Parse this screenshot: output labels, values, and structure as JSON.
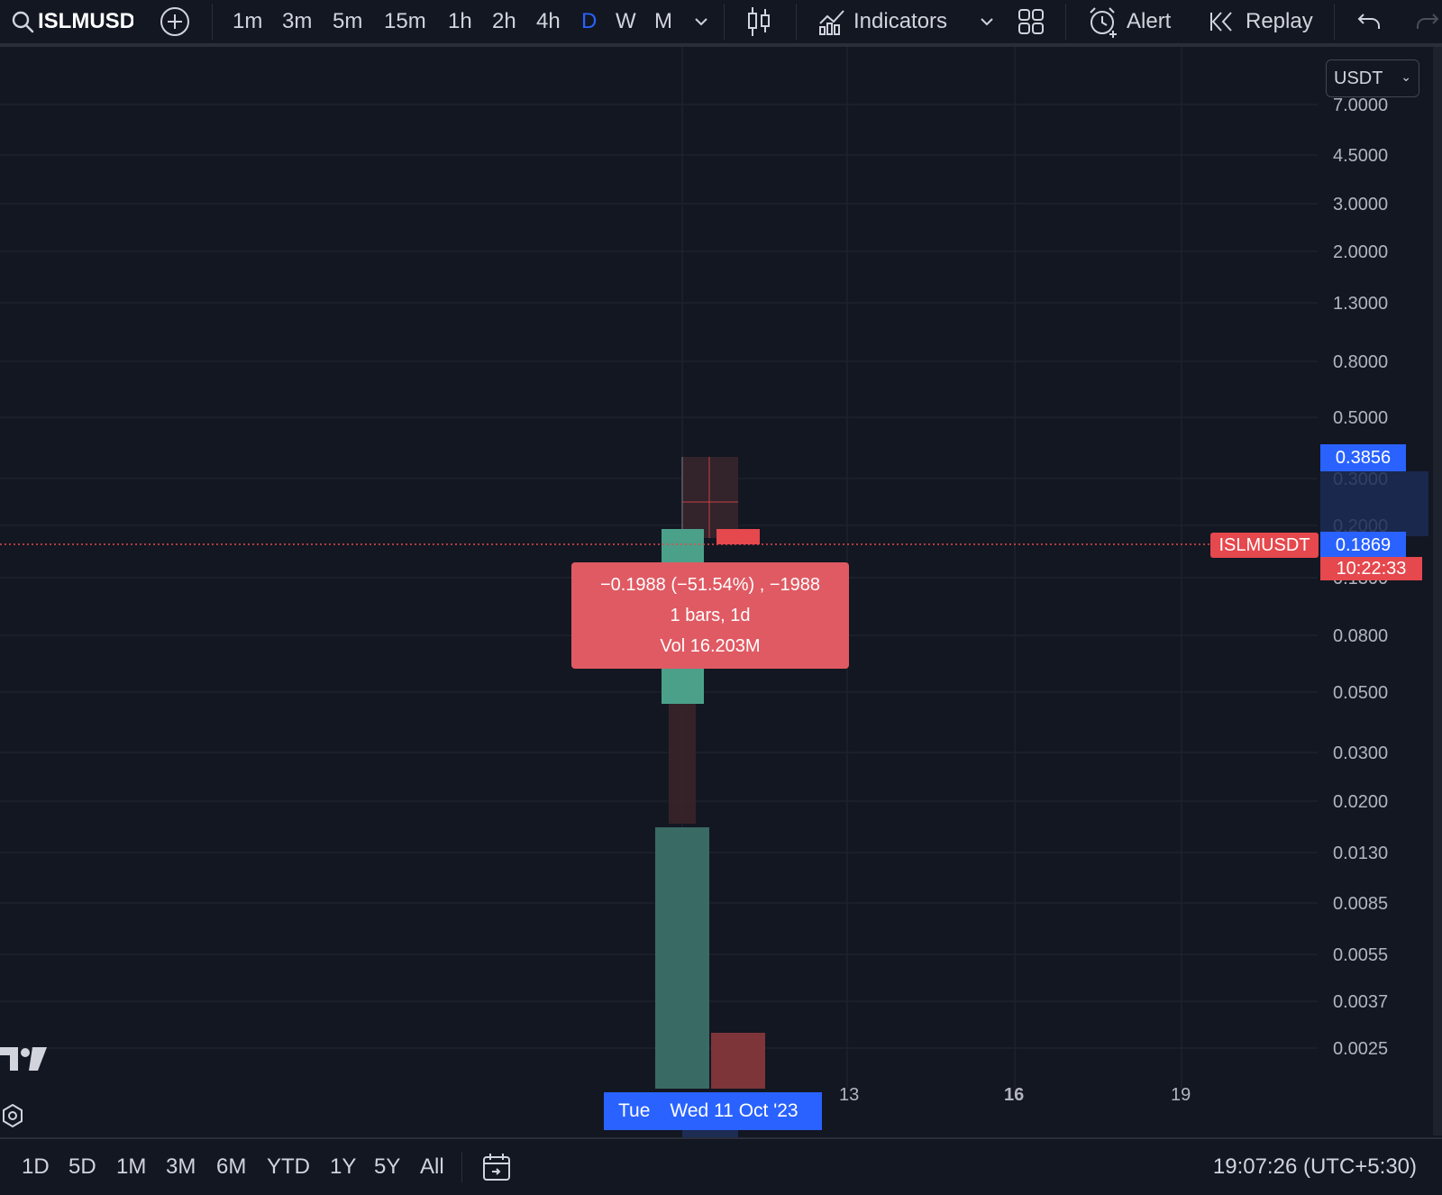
{
  "toolbar": {
    "symbol": "ISLMUSDT",
    "intervals": [
      "1m",
      "3m",
      "5m",
      "15m",
      "1h",
      "2h",
      "4h",
      "D",
      "W",
      "M"
    ],
    "active_interval": "D",
    "indicators_label": "Indicators",
    "alert_label": "Alert",
    "replay_label": "Replay"
  },
  "chart": {
    "currency": "USDT",
    "price_axis": [
      "7.0000",
      "4.5000",
      "3.0000",
      "2.0000",
      "1.3000",
      "0.8000",
      "0.5000",
      "0.3000",
      "0.2000",
      "0.1300",
      "0.0800",
      "0.0500",
      "0.0300",
      "0.0200",
      "0.0130",
      "0.0085",
      "0.0055",
      "0.0037",
      "0.0025"
    ],
    "time_axis": {
      "highlight_left": "Tue",
      "highlight_main": "Wed 11 Oct '23",
      "ticks": [
        "13",
        "16",
        "19"
      ],
      "bold_tick": "16"
    },
    "crosshair_price": "0.3856",
    "symbol_tag": "ISLMUSDT",
    "last_price": "0.1869",
    "countdown": "10:22:33",
    "measure": {
      "change": "−0.1988 (−51.54%) , −1988",
      "bars": "1 bars, 1d",
      "volume": "Vol 16.203M"
    },
    "colors": {
      "background": "#131722",
      "up": "#4ba08a",
      "down": "#e5484d",
      "accent": "#2962ff",
      "measure_box": "#e05a63"
    }
  },
  "bottombar": {
    "ranges": [
      "1D",
      "5D",
      "1M",
      "3M",
      "6M",
      "YTD",
      "1Y",
      "5Y",
      "All"
    ],
    "clock": "19:07:26 (UTC+5:30)"
  }
}
